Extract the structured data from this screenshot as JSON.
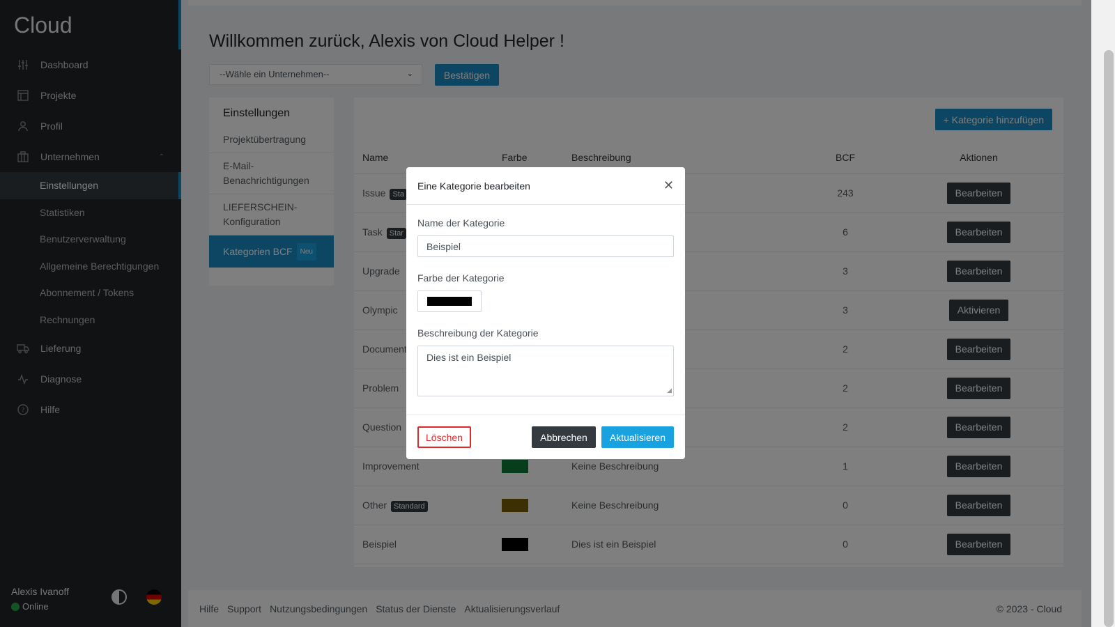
{
  "brand": "Cloud",
  "nav": {
    "dashboard": "Dashboard",
    "projekte": "Projekte",
    "profil": "Profil",
    "unternehmen": "Unternehmen",
    "sub": [
      "Einstellungen",
      "Statistiken",
      "Benutzerverwaltung",
      "Allgemeine Berechtigungen",
      "Abonnement / Tokens",
      "Rechnungen"
    ],
    "lieferung": "Lieferung",
    "diagnose": "Diagnose",
    "hilfe": "Hilfe"
  },
  "user": {
    "name": "Alexis Ivanoff",
    "status": "Online"
  },
  "main": {
    "welcome": "Willkommen zurück, Alexis von Cloud Helper !",
    "company_select": "--Wähle ein Unternehmen--",
    "confirm": "Bestätigen"
  },
  "settings": {
    "title": "Einstellungen",
    "links": [
      "Projektübertragung",
      "E-Mail-Benachrichtigungen",
      "LIEFERSCHEIN-Konfiguration",
      "Kategorien BCF"
    ],
    "new_badge": "Neu"
  },
  "table": {
    "add_button": "+ Kategorie hinzufügen",
    "headers": [
      "Name",
      "Farbe",
      "Beschreibung",
      "BCF",
      "Aktionen"
    ],
    "standard_badge": "Standard",
    "rows": [
      {
        "name": "Issue",
        "badge": "Sta",
        "color": "",
        "desc": "",
        "bcf": "243",
        "action": "Bearbeiten"
      },
      {
        "name": "Task",
        "badge": "Star",
        "color": "",
        "desc": "",
        "bcf": "6",
        "action": "Bearbeiten"
      },
      {
        "name": "Upgrade",
        "badge": "",
        "color": "",
        "desc": "",
        "bcf": "3",
        "action": "Bearbeiten"
      },
      {
        "name": "Olympic",
        "badge": "",
        "color": "",
        "desc": "",
        "bcf": "3",
        "action": "Aktivieren"
      },
      {
        "name": "Document",
        "badge": "",
        "color": "",
        "desc": "",
        "bcf": "2",
        "action": "Bearbeiten"
      },
      {
        "name": "Problem",
        "badge": "",
        "color": "",
        "desc": "",
        "bcf": "2",
        "action": "Bearbeiten"
      },
      {
        "name": "Question",
        "badge": "",
        "color": "",
        "desc": "",
        "bcf": "2",
        "action": "Bearbeiten"
      },
      {
        "name": "Improvement",
        "badge": "",
        "color": "#0e7a3a",
        "desc": "Keine Beschreibung",
        "bcf": "1",
        "action": "Bearbeiten"
      },
      {
        "name": "Other",
        "badge": "Standard",
        "color": "#7a5f08",
        "desc": "Keine Beschreibung",
        "bcf": "0",
        "action": "Bearbeiten"
      },
      {
        "name": "Beispiel",
        "badge": "",
        "color": "#000000",
        "desc": "Dies ist ein Beispiel",
        "bcf": "0",
        "action": "Bearbeiten"
      }
    ]
  },
  "footer": {
    "links": [
      "Hilfe",
      "Support",
      "Nutzungsbedingungen",
      "Status der Dienste",
      "Aktualisierungsverlauf"
    ],
    "copyright": "© 2023 - Cloud"
  },
  "modal": {
    "title": "Eine Kategorie bearbeiten",
    "name_label": "Name der Kategorie",
    "name_value": "Beispiel",
    "color_label": "Farbe der Kategorie",
    "color_value": "#000000",
    "desc_label": "Beschreibung der Kategorie",
    "desc_value": "Dies ist ein Beispiel",
    "delete": "Löschen",
    "cancel": "Abbrechen",
    "update": "Aktualisieren"
  }
}
